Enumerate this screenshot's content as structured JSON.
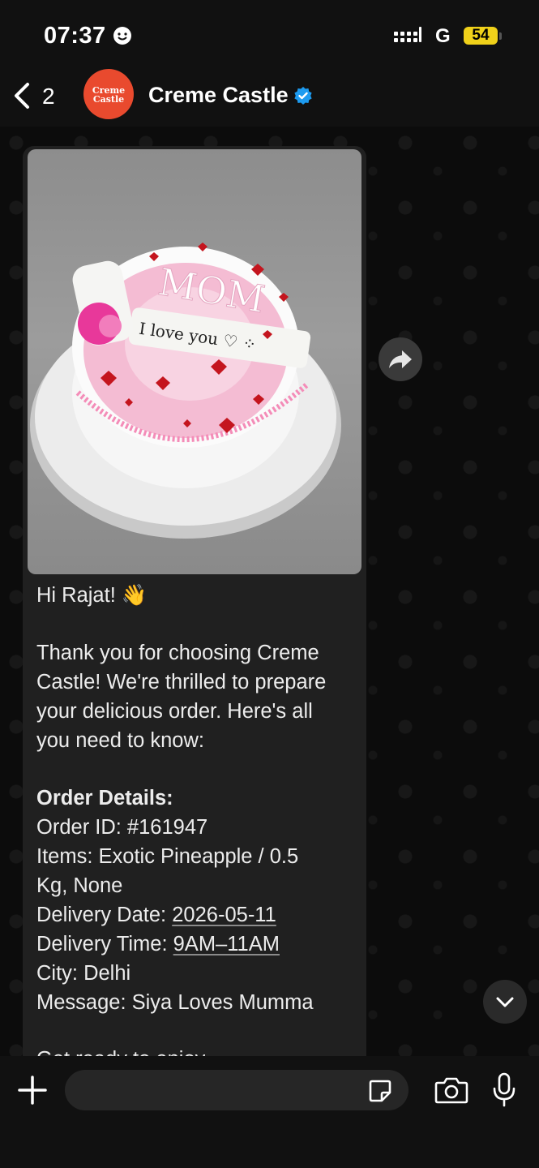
{
  "status_bar": {
    "time": "07:37",
    "network": "G",
    "battery": "54"
  },
  "header": {
    "unread_count": "2",
    "contact_name": "Creme Castle",
    "avatar_text_line1": "Creme",
    "avatar_text_line2": "Castle"
  },
  "message": {
    "photo": {
      "cake_text": "MOM",
      "topper_text": "I love you ♡ ⁘"
    },
    "greeting": "Hi Rajat! 👋",
    "intro_lines": [
      "Thank you for choosing Creme",
      "Castle! We're thrilled to prepare",
      "your delicious order. Here's all",
      "you need to know:"
    ],
    "order_heading": "Order Details:",
    "order_id": "Order ID: #161947",
    "items_line1": "Items: Exotic Pineapple / 0.5",
    "items_line2": "Kg, None",
    "delivery_date_label": "Delivery Date: ",
    "delivery_date": "2026-05-11",
    "delivery_time_label": "Delivery Time: ",
    "delivery_time": "9AM–11AM",
    "city": "City: Delhi",
    "gift_message": "Message: Siya Loves Mumma",
    "cut_off": "Get ready to enjoy"
  },
  "composer": {
    "placeholder": ""
  },
  "colors": {
    "background": "#0b0b0b",
    "bubble": "#202020",
    "avatar": "#e94a2e",
    "verified": "#1d9bf0",
    "battery": "#f0d11a"
  }
}
